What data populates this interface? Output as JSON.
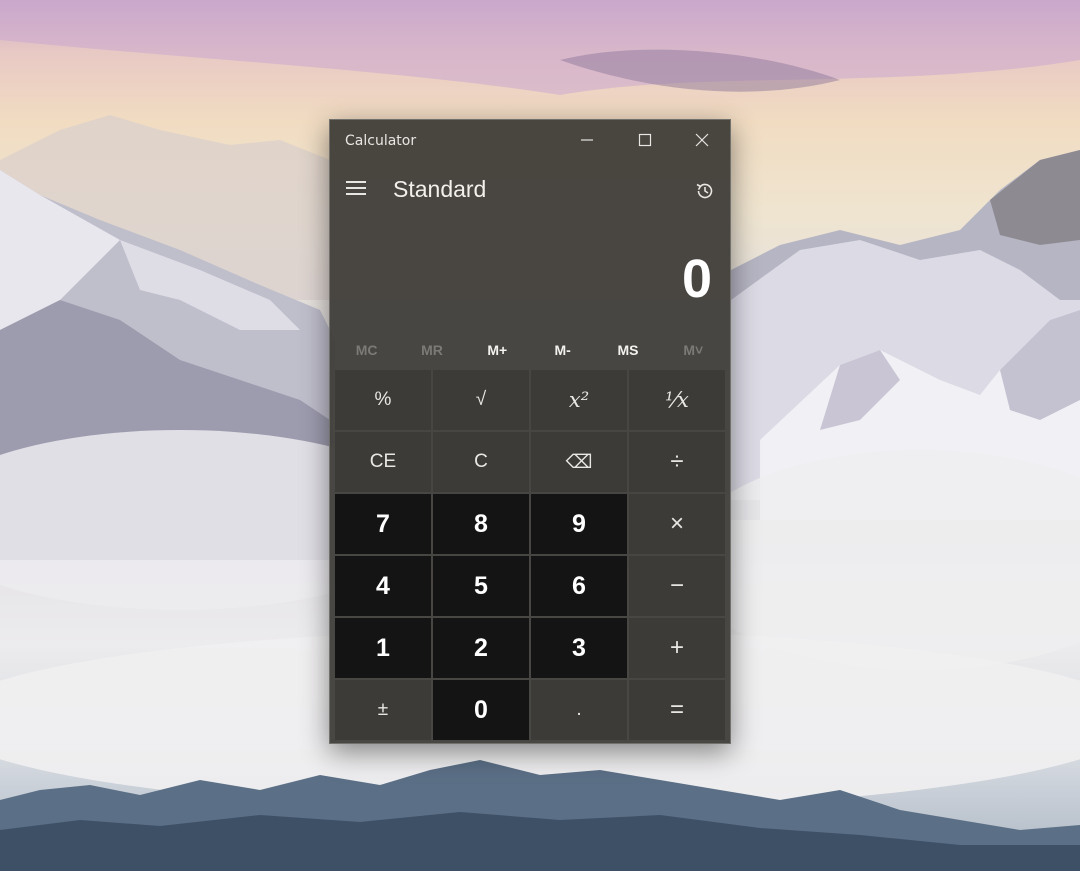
{
  "window": {
    "title": "Calculator",
    "controls": {
      "minimize": "minimize",
      "maximize": "maximize",
      "close": "close"
    }
  },
  "header": {
    "mode": "Standard",
    "menu_icon": "hamburger-menu-icon",
    "history_icon": "history-icon"
  },
  "display": {
    "value": "0"
  },
  "memory": [
    "MC",
    "MR",
    "M+",
    "M-",
    "MS",
    "M˅"
  ],
  "keys": {
    "percent": "%",
    "sqrt": "√",
    "square": "x²",
    "reciprocal": "⅟x",
    "ce": "CE",
    "c": "C",
    "backspace": "⌫",
    "divide": "÷",
    "seven": "7",
    "eight": "8",
    "nine": "9",
    "multiply": "×",
    "four": "4",
    "five": "5",
    "six": "6",
    "minus": "−",
    "one": "1",
    "two": "2",
    "three": "3",
    "plus": "+",
    "negate": "±",
    "zero": "0",
    "decimal": ".",
    "equals": "="
  },
  "colors": {
    "window_bg": "#3c3a36",
    "number_key": "#141414",
    "function_key": "#3d3b38",
    "text": "#ffffff",
    "disabled_text": "#7c7a76"
  }
}
